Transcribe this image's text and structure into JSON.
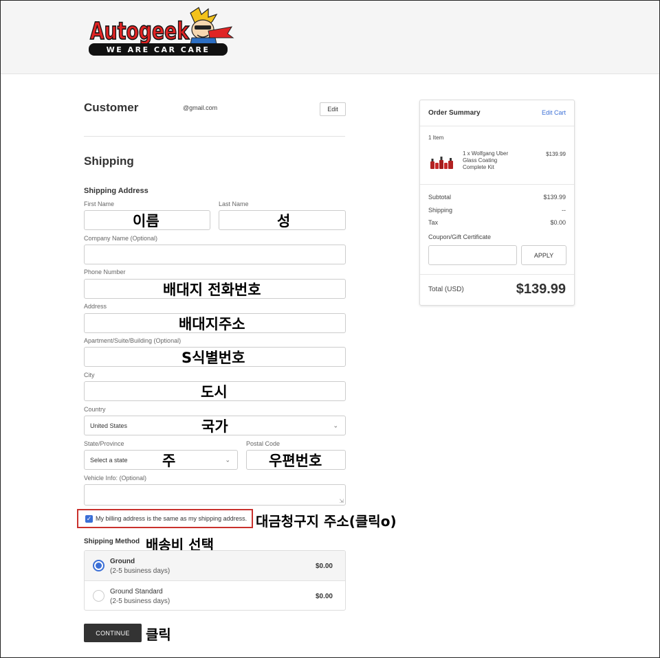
{
  "header": {
    "logo": {
      "brand": "Autogeek",
      "tagline": "WE ARE CAR CARE"
    }
  },
  "customer": {
    "title": "Customer",
    "email": "@gmail.com",
    "edit_label": "Edit"
  },
  "shipping": {
    "title": "Shipping",
    "address_heading": "Shipping Address",
    "fields": {
      "first_name": {
        "label": "First Name",
        "annotation": "이름"
      },
      "last_name": {
        "label": "Last Name",
        "annotation": "성"
      },
      "company": {
        "label": "Company Name (Optional)"
      },
      "phone": {
        "label": "Phone Number",
        "annotation": "배대지 전화번호"
      },
      "address": {
        "label": "Address",
        "annotation": "배대지주소"
      },
      "apartment": {
        "label": "Apartment/Suite/Building (Optional)",
        "annotation": "S식별번호"
      },
      "city": {
        "label": "City",
        "annotation": "도시"
      },
      "country": {
        "label": "Country",
        "value": "United States",
        "annotation": "국가"
      },
      "state": {
        "label": "State/Province",
        "value": "Select a state",
        "annotation": "주"
      },
      "postal": {
        "label": "Postal Code",
        "annotation": "우편번호"
      },
      "vehicle": {
        "label": "Vehicle Info: (Optional)"
      }
    },
    "billing_same": {
      "label": "My billing address is the same as my shipping address.",
      "checked": true,
      "annotation": "대금청구지 주소(클릭o)"
    },
    "method": {
      "heading": "Shipping Method",
      "annotation": "배송비 선택",
      "options": [
        {
          "name": "Ground",
          "detail": "(2-5 business days)",
          "price": "$0.00",
          "selected": true
        },
        {
          "name": "Ground Standard",
          "detail": "(2-5 business days)",
          "price": "$0.00",
          "selected": false
        }
      ]
    },
    "continue_label": "CONTINUE",
    "continue_annotation": "클릭"
  },
  "summary": {
    "title": "Order Summary",
    "edit_cart": "Edit Cart",
    "item_count": "1 Item",
    "item": {
      "line1": "1 x Wolfgang Uber",
      "line2": "Glass Coating",
      "line3": "Complete Kit",
      "price": "$139.99"
    },
    "subtotal_label": "Subtotal",
    "subtotal": "$139.99",
    "shipping_label": "Shipping",
    "shipping": "--",
    "tax_label": "Tax",
    "tax": "$0.00",
    "coupon_label": "Coupon/Gift Certificate",
    "apply_label": "APPLY",
    "total_label": "Total (USD)",
    "total": "$139.99"
  },
  "colors": {
    "accent": "#3b6fd6",
    "annotation_box": "#c9302c",
    "button_dark": "#333333",
    "logo_red": "#e02424"
  }
}
